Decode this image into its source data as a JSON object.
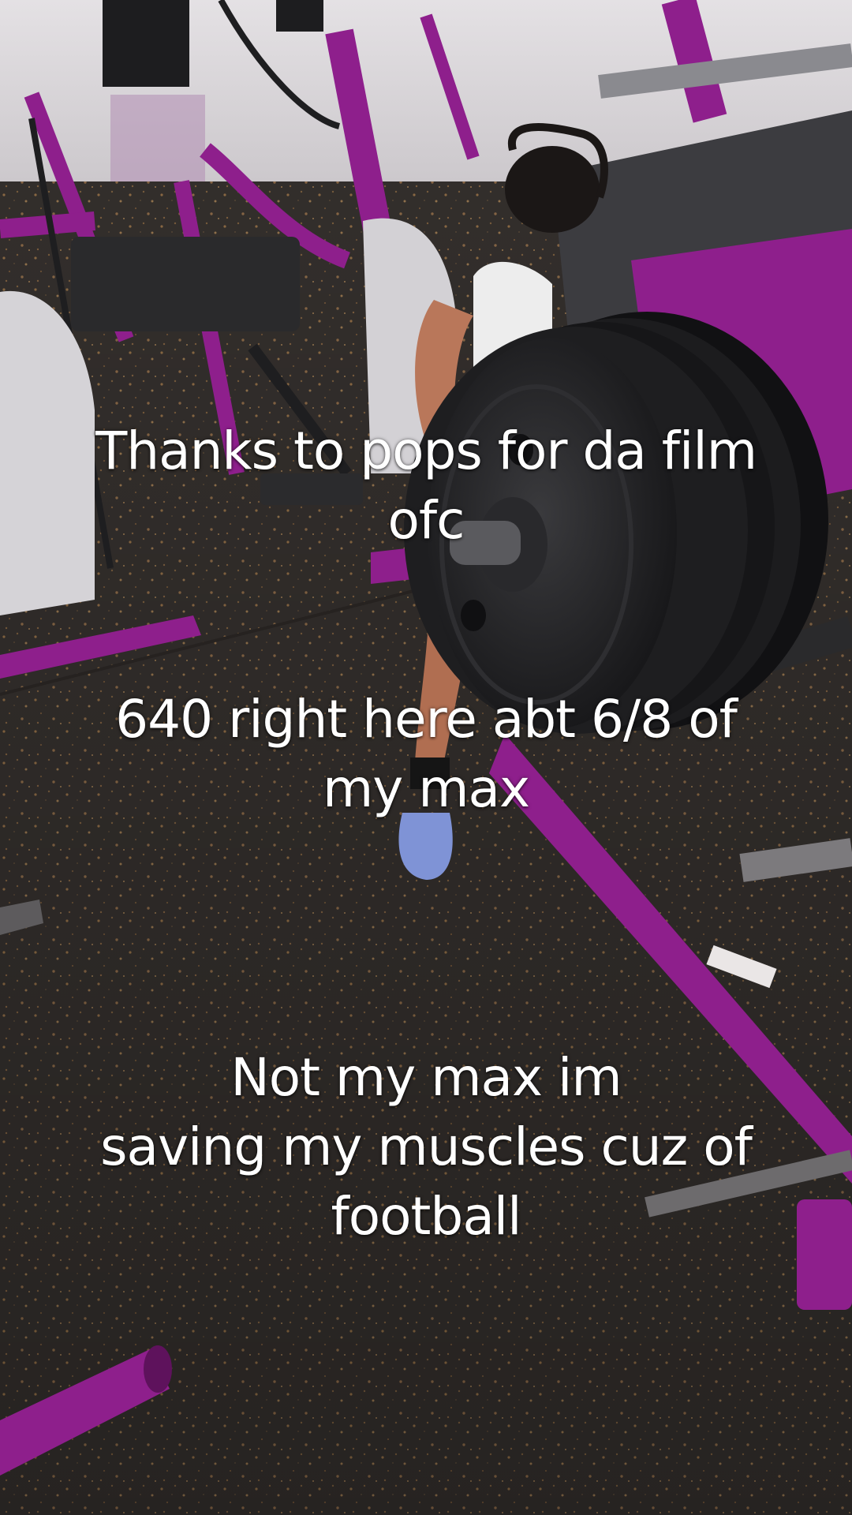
{
  "captions": {
    "first": "Thanks to pops for da film\nofc",
    "second": "640 right here abt 6/8 of\nmy max",
    "third": "Not my max im\nsaving my muscles cuz of\nfootball"
  },
  "colors": {
    "floor": "#3a3532",
    "machine_purple": "#8e1f8c",
    "wall": "#d9d6da",
    "plates": "#1f1f21"
  }
}
